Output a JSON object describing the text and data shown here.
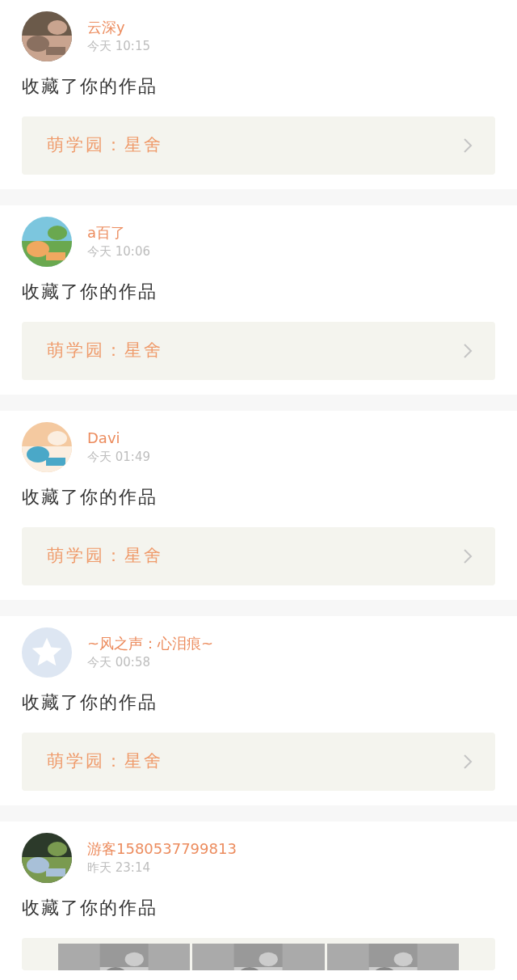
{
  "feed": [
    {
      "user": "云深y",
      "time": "今天 10:15",
      "action": "收藏了你的作品",
      "work": {
        "kind": "link",
        "title": "萌学园：星舍"
      }
    },
    {
      "user": "a百了",
      "time": "今天 10:06",
      "action": "收藏了你的作品",
      "work": {
        "kind": "link",
        "title": "萌学园：星舍"
      }
    },
    {
      "user": "Davi",
      "time": "今天 01:49",
      "action": "收藏了你的作品",
      "work": {
        "kind": "link",
        "title": "萌学园：星舍"
      }
    },
    {
      "user": "~风之声：心泪痕~",
      "time": "今天 00:58",
      "avatar": {
        "kind": "default"
      },
      "action": "收藏了你的作品",
      "work": {
        "kind": "link",
        "title": "萌学园：星舍"
      }
    },
    {
      "user": "游客1580537799813",
      "time": "昨天 23:14",
      "action": "收藏了你的作品",
      "work": {
        "kind": "pictures"
      }
    }
  ]
}
